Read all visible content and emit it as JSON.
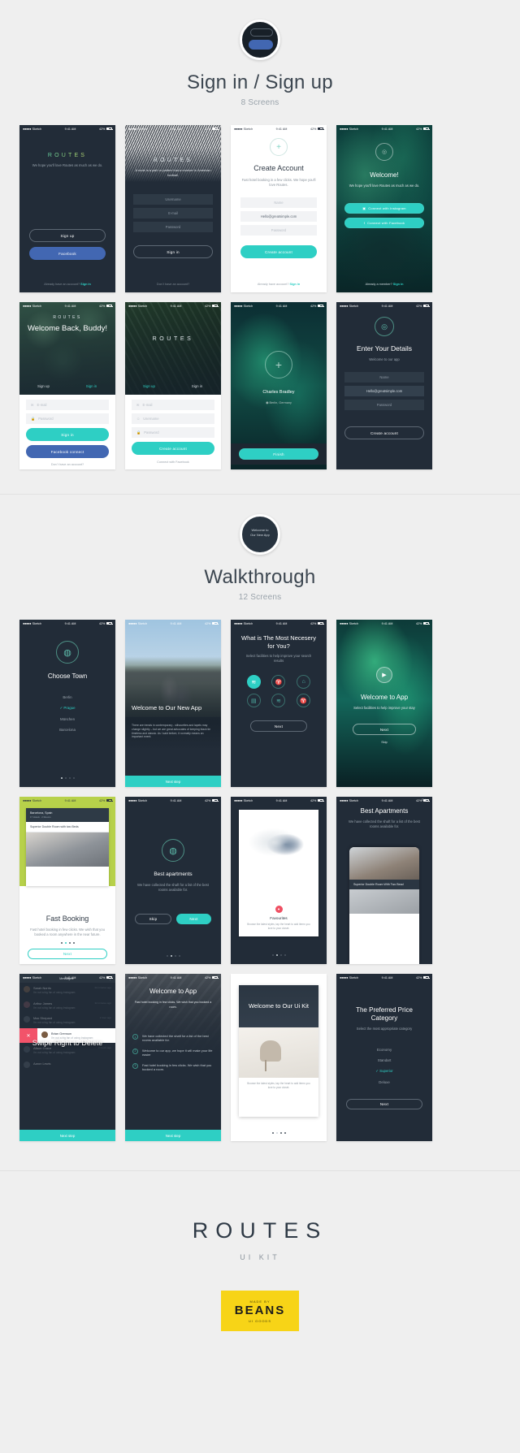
{
  "sections": [
    {
      "id": "signin",
      "title": "Sign in / Sign up",
      "subtitle": "8 Screens"
    },
    {
      "id": "walkthrough",
      "title": "Walkthrough",
      "subtitle": "12 Screens"
    }
  ],
  "status_bar": {
    "carrier": "Sketch",
    "time": "9:41 AM",
    "battery": "42%"
  },
  "screens": {
    "s1": {
      "brand": "ROUTES",
      "tagline": "We hope you'll love Routes as much as we do.",
      "signup": "Sign up",
      "facebook": "Facebook",
      "footnote": "Already have an account?",
      "footnote_link": "Sign in"
    },
    "s2": {
      "brand": "ROUTES",
      "tagline": "A route is a path or pattern that a receiver in American football.",
      "username": "Username",
      "email": "E-mail",
      "password": "Password",
      "signin": "Sign in",
      "footnote": "Don`t have an account?"
    },
    "s3": {
      "title": "Create Account",
      "tagline": "Fast hotel booking in a few clicks. We hope you'll love Routes.",
      "name": "Name",
      "email": "Hello@greatsimple.com",
      "password": "Password",
      "cta": "Create account",
      "footnote": "Already have account?",
      "footnote_link": "Sign in"
    },
    "s4": {
      "title": "Welcome!",
      "tagline": "We hope you'll love Routes as much as we do.",
      "instagram": "Connect with Instagram",
      "facebook": "Connect with Facebook",
      "footnote": "Already a member?",
      "footnote_link": "Sign in"
    },
    "s5": {
      "brand": "ROUTES",
      "title": "Welcome Back, Buddy!",
      "tab_signup": "Sign up",
      "tab_signin": "Sign in",
      "email": "E-mail",
      "password": "Password",
      "signin": "Sign in",
      "facebook": "Facebook connect",
      "footnote": "Don`t have an account?"
    },
    "s6": {
      "brand": "ROUTES",
      "tab_signup": "Sign up",
      "tab_signin": "Sign in",
      "email": "E-mail",
      "username": "Username",
      "password": "Password",
      "cta": "Create account",
      "facebook": "Connect with Facebook"
    },
    "s7": {
      "name": "Charles Bradley",
      "location": "Berlin, Germany",
      "finish": "Finish"
    },
    "s8": {
      "title": "Enter Your Details",
      "subtitle": "Welcome to our app",
      "name": "Name",
      "email": "Hello@greatsimple.com",
      "password": "Password",
      "cta": "Create account"
    },
    "w1": {
      "title": "Choose Town",
      "towns": [
        "Berlin",
        "Prague",
        "München",
        "Barcelona"
      ],
      "selected": "Prague"
    },
    "w2": {
      "title": "Welcome to Our New App",
      "body": "There are trends in contemporary - silhouettes and lapels may change slightly – but we are great advocates of keeping black tie timeless and classic. As I said before, it normally means an important event.",
      "cta": "Next step"
    },
    "w3": {
      "title": "What is The Most Necesery for You?",
      "subtitle": "Select facilities to help improve your search results",
      "cta": "Next",
      "icons": [
        "wifi",
        "restaurant",
        "home",
        "tv",
        "wifi",
        "restaurant"
      ]
    },
    "w4": {
      "title": "Welcome to App",
      "subtitle": "Select facilities to help improve your stay",
      "cta": "Next",
      "skip": "Skip"
    },
    "w5": {
      "card_city": "Barcelona, Spain",
      "card_meta": "17 Hotels · 2 Rooms",
      "room_title": "Superior Double Room with two Beds",
      "title": "Fast Booking",
      "body": "Fast hotel booking in few clicks. We wish that you booked a room anywhere in the near future.",
      "cta": "Next"
    },
    "w6": {
      "title": "Best apartments",
      "body": "We have collected the shaft for a list of the best rooms available for.",
      "skip": "Skip",
      "cta": "Next"
    },
    "w7": {
      "title": "Favourites",
      "body": "Browse the latest styles, tap the heart to add items you love to your closet."
    },
    "w8": {
      "skip": "Skip",
      "title": "Best Apartments",
      "body": "We have collected the shaft for a list of the best rooms available for.",
      "room_title": "Superior Double Room With Two Bead"
    },
    "w9": {
      "header": "Messages",
      "title": "Swipe Right to Delete",
      "cta": "Next step",
      "messages": [
        {
          "name": "Sarah Norris",
          "text": "I'm not a big fan of using Instagram",
          "time": "20 minutes ago"
        },
        {
          "name": "Arthur James",
          "text": "I'm not a big fan of using Instagram",
          "time": "32 minutes ago"
        },
        {
          "name": "Max Shepard",
          "text": "I'm not a big fan of using Instagram",
          "time": "1 hour ago"
        },
        {
          "name": "Brian Grenson",
          "text": "I'm not a big fan of using Instagram",
          "time": ""
        },
        {
          "name": "Alison Grace",
          "text": "I'm not a big fan of using Instagram",
          "time": "2 hours ago"
        },
        {
          "name": "Aaron Lewis",
          "text": "",
          "time": ""
        }
      ]
    },
    "w10": {
      "title": "Welcome to App",
      "subtitle": "Fast hotel booking in few clicks. We wish that you booked a room.",
      "items": [
        "We have collected the shaft for a list of the best rooms available for.",
        "Welcome to our app, we hope it will make your life easier",
        "Fast hotel booking in few clicks. We wish that you booked a room."
      ],
      "cta": "Next step"
    },
    "w11": {
      "title": "Welcome to Our Ui Kit",
      "body": "Browse the latest styles, tap the heart to add items you love to your closet."
    },
    "w12": {
      "title": "The Preferred Price Category",
      "subtitle": "Select the most appropriate category",
      "options": [
        "Economy",
        "Standart",
        "Superior",
        "Deluxe"
      ],
      "selected": "Superior",
      "cta": "Next"
    }
  },
  "footer": {
    "brand": "ROUTES",
    "subtitle": "UI KIT",
    "badge_by": "MADE BY",
    "badge_name": "BEANS",
    "badge_goods": "UI GOODS"
  },
  "colors": {
    "teal": "#2ecfc4",
    "facebook_blue": "#4267b2",
    "dark": "#222c38",
    "page_bg": "#efefef"
  }
}
